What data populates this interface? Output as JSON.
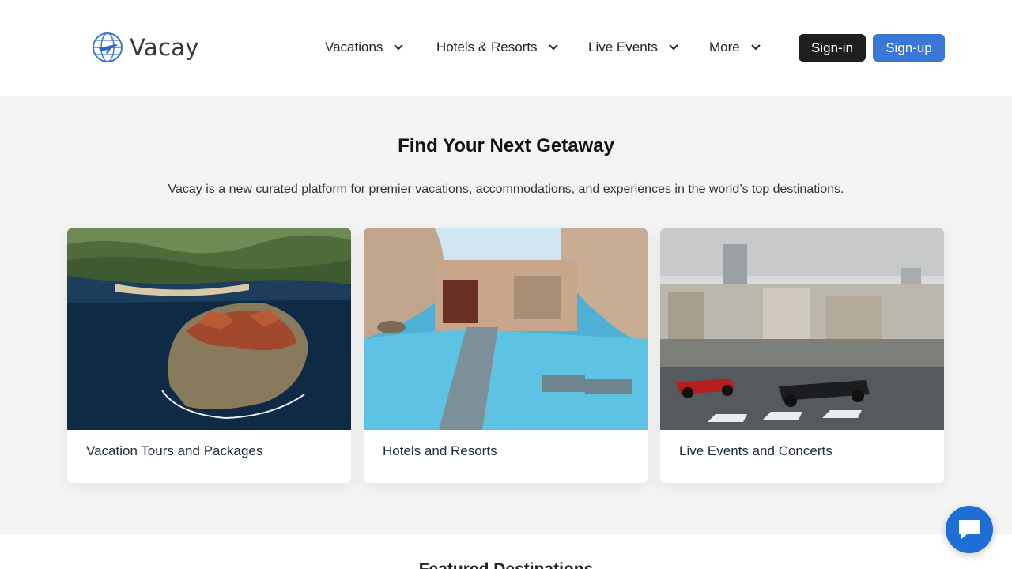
{
  "brand": {
    "name": "Vacay"
  },
  "nav": {
    "items": [
      {
        "label": "Vacations"
      },
      {
        "label": "Hotels & Resorts"
      },
      {
        "label": "Live Events"
      },
      {
        "label": "More"
      }
    ],
    "signin_label": "Sign-in",
    "signup_label": "Sign-up"
  },
  "hero": {
    "title": "Find Your Next Getaway",
    "subtitle": "Vacay is a new curated platform for premier vacations, accommodations, and experiences in the world’s top destinations."
  },
  "cards": [
    {
      "label": "Vacation Tours and Packages"
    },
    {
      "label": "Hotels and Resorts"
    },
    {
      "label": "Live Events and Concerts"
    }
  ],
  "featured": {
    "title": "Featured Destinations"
  },
  "colors": {
    "accent": "#3a78d8",
    "dark": "#1f1f1f",
    "chat": "#1f6ed4"
  },
  "icons": {
    "logo": "globe-plane-icon",
    "nav_chevron": "chevron-down-icon",
    "chat": "chat-bubble-icon"
  }
}
